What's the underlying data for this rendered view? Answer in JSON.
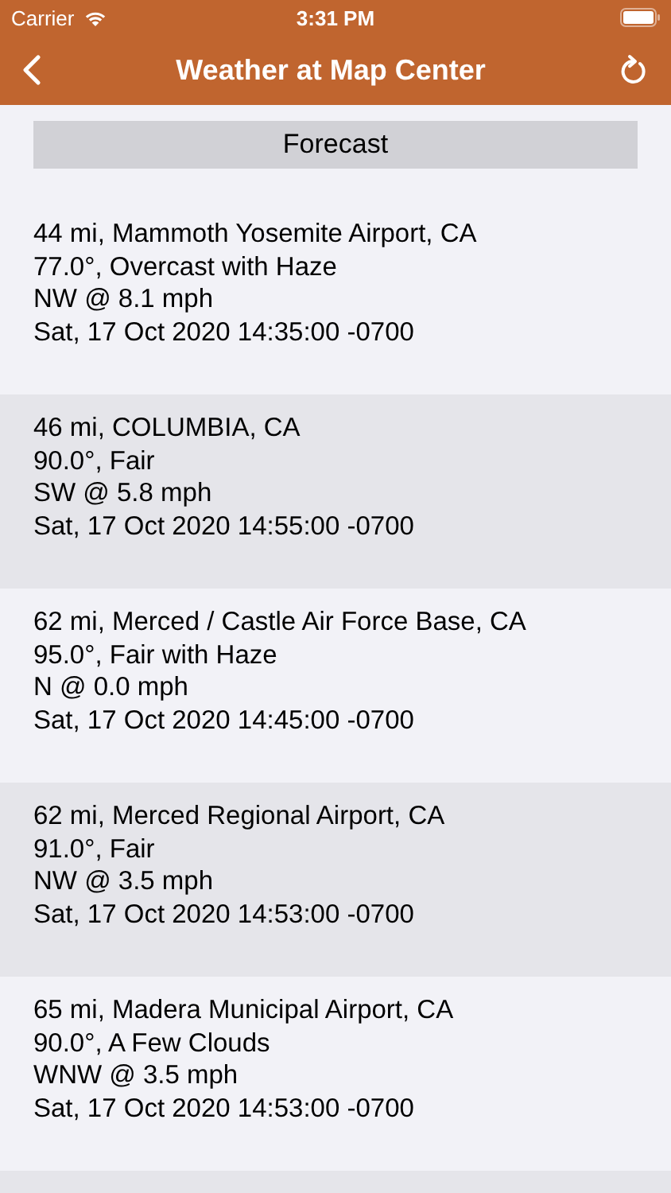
{
  "status_bar": {
    "carrier": "Carrier",
    "time": "3:31 PM"
  },
  "nav": {
    "title": "Weather at Map Center"
  },
  "forecast_button": "Forecast",
  "stations": [
    {
      "lines": [
        "44 mi, Mammoth Yosemite Airport, CA",
        "77.0°, Overcast with Haze",
        "NW @ 8.1 mph",
        "Sat, 17 Oct 2020 14:35:00 -0700"
      ]
    },
    {
      "lines": [
        "46 mi, COLUMBIA, CA",
        "90.0°, Fair",
        "SW @ 5.8 mph",
        "Sat, 17 Oct 2020 14:55:00 -0700"
      ]
    },
    {
      "lines": [
        "62 mi, Merced / Castle Air Force Base, CA",
        "95.0°, Fair with Haze",
        "N @ 0.0 mph",
        "Sat, 17 Oct 2020 14:45:00 -0700"
      ]
    },
    {
      "lines": [
        "62 mi, Merced Regional Airport, CA",
        "91.0°, Fair",
        "NW @ 3.5 mph",
        "Sat, 17 Oct 2020 14:53:00 -0700"
      ]
    },
    {
      "lines": [
        "65 mi, Madera Municipal Airport, CA",
        "90.0°, A Few Clouds",
        "WNW @ 3.5 mph",
        "Sat, 17 Oct 2020 14:53:00 -0700"
      ]
    }
  ]
}
